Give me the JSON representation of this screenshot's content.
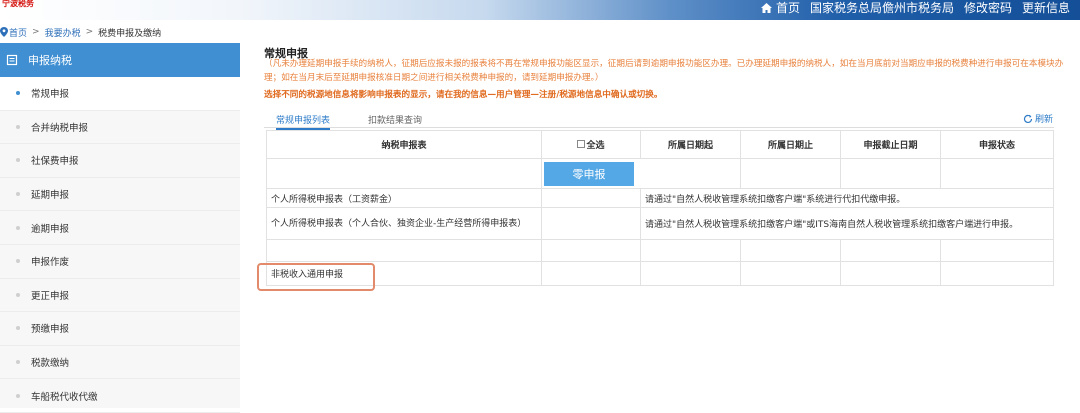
{
  "header": {
    "logo_text": "宁波税务",
    "nav": [
      "首页",
      "国家税务总局儋州市税务局",
      "修改密码",
      "更新信息"
    ]
  },
  "breadcrumb": [
    "首页",
    "我要办税",
    "税费申报及缴纳"
  ],
  "sidebar": {
    "title": "申报纳税",
    "items": [
      "常规申报",
      "合并纳税申报",
      "社保费申报",
      "延期申报",
      "逾期申报",
      "申报作废",
      "更正申报",
      "预缴申报",
      "税款缴纳",
      "车船税代收代缴"
    ]
  },
  "main": {
    "title": "常规申报",
    "notice": "（凡未办理延期申报手续的纳税人，征期后应报未报的报表将不再在常规申报功能区显示，征期后请到逾期申报功能区办理。已办理延期申报的纳税人，如在当月底前对当期应申报的税费种进行申报可在本模块办理；如在当月末后至延期申报核准日期之间进行相关税费种申报的，请到延期申报办理。）",
    "notice2": "选择不同的税源地信息将影响申报表的显示，请在我的信息—用户管理—注册/税源地信息中确认或切换。",
    "tabs": [
      "常规申报列表",
      "扣款结果查询"
    ],
    "refresh_label": "刷新"
  },
  "table": {
    "headers": [
      "纳税申报表",
      "全选",
      "所属日期起",
      "所属日期止",
      "申报截止日期",
      "申报状态"
    ],
    "zero_button": "零申报",
    "rows": [
      {
        "name": "个人所得税申报表（工资薪金）",
        "note": "请通过\"自然人税收管理系统扣缴客户端\"系统进行代扣代缴申报。"
      },
      {
        "name": "个人所得税申报表（个人合伙、独资企业-生产经营所得申报表）",
        "note": "请通过\"自然人税收管理系统扣缴客户端\"或ITS海南自然人税收管理系统扣缴客户端进行申报。"
      },
      {
        "name": "",
        "note": ""
      },
      {
        "name": "非税收入通用申报",
        "note": ""
      }
    ]
  },
  "colors": {
    "accent": "#3f8fd2",
    "notice": "#e8823e",
    "highlight": "#e38a6b"
  }
}
